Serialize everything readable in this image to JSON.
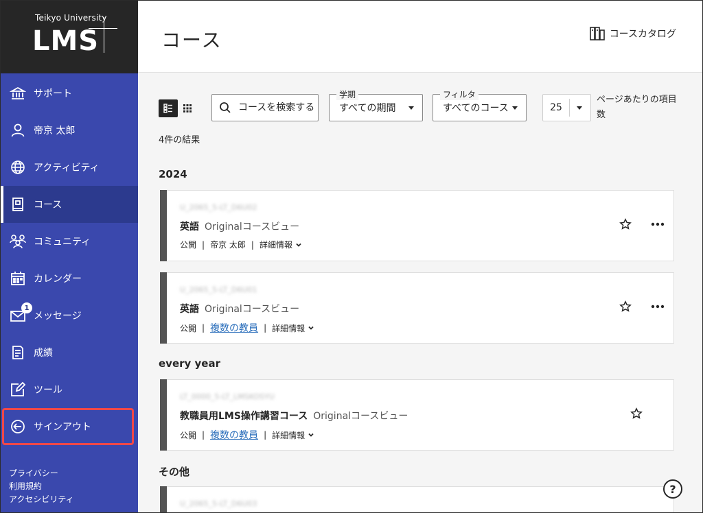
{
  "brand": {
    "university": "Teikyo University",
    "product": "LMS"
  },
  "sidebar": {
    "items": [
      {
        "label": "サポート",
        "icon": "institution-icon"
      },
      {
        "label": "帝京 太郎",
        "icon": "user-icon"
      },
      {
        "label": "アクティビティ",
        "icon": "globe-icon"
      },
      {
        "label": "コース",
        "icon": "book-icon",
        "active": true
      },
      {
        "label": "コミュニティ",
        "icon": "people-icon"
      },
      {
        "label": "カレンダー",
        "icon": "calendar-icon"
      },
      {
        "label": "メッセージ",
        "icon": "envelope-icon",
        "badge": "1"
      },
      {
        "label": "成績",
        "icon": "grades-icon"
      },
      {
        "label": "ツール",
        "icon": "edit-icon"
      },
      {
        "label": "サインアウト",
        "icon": "signout-icon",
        "highlight_color": "#f04848"
      }
    ],
    "footer": [
      "プライバシー",
      "利用規約",
      "アクセシビリティ"
    ]
  },
  "header": {
    "title": "コース",
    "catalog_label": "コースカタログ"
  },
  "toolbar": {
    "search_placeholder": "コースを検索する",
    "term": {
      "legend": "学期",
      "value": "すべての期間"
    },
    "filter": {
      "legend": "フィルタ",
      "value": "すべてのコース"
    },
    "per_page": {
      "value": "25",
      "label": "ページあたりの項目数"
    }
  },
  "results_label": "4件の結果",
  "groups": [
    {
      "title": "2024"
    },
    {
      "title": "every year"
    },
    {
      "title": "その他"
    }
  ],
  "courses": [
    {
      "id": "U_2065_5-LT_D6U02",
      "name": "英語",
      "view": "Originalコースビュー",
      "status": "公開",
      "instructor": "帝京 太郎",
      "instructor_link": false,
      "details": "詳細情報"
    },
    {
      "id": "U_2065_5-LT_D6U01",
      "name": "英語",
      "view": "Originalコースビュー",
      "status": "公開",
      "instructor": "複数の教員",
      "instructor_link": true,
      "details": "詳細情報"
    },
    {
      "id": "LT_0000_5-LT_LMSKOSYU",
      "name": "教職員用LMS操作講習コース",
      "view": "Originalコースビュー",
      "status": "公開",
      "instructor": "複数の教員",
      "instructor_link": true,
      "details": "詳細情報"
    },
    {
      "id": "U_2065_5-LT_D6U03"
    }
  ],
  "colors": {
    "sidebar": "#3a48ad",
    "sidebar_active": "#2c3a8e",
    "logo_bg": "#262626",
    "link": "#2a6ebb",
    "signout_outline": "#f04848"
  },
  "help_label": "?"
}
